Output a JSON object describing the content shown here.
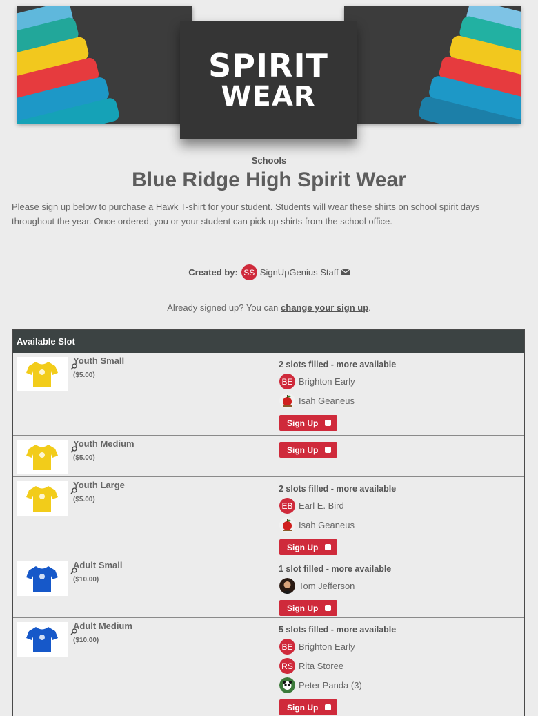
{
  "banner": {
    "line1": "SPIRIT",
    "line2": "WEAR"
  },
  "category": "Schools",
  "title": "Blue Ridge High Spirit Wear",
  "description": "Please sign up below to purchase a Hawk T-shirt for your student. Students will wear these shirts on school spirit days throughout the year.  Once ordered, you or your student can pick up shirts from the school office.",
  "creator": {
    "label": "Created by:",
    "initials": "SS",
    "name": "SignUpGenius Staff"
  },
  "already": {
    "prefix": "Already signed up? You can ",
    "link": "change your sign up",
    "suffix": "."
  },
  "table": {
    "header": "Available Slot",
    "signup_label": "Sign Up",
    "rows": [
      {
        "name": "Youth Small",
        "price": "($5.00)",
        "shirt_color": "#f2cc1a",
        "filled": "2 slots filled - more available",
        "people": [
          {
            "initials": "BE",
            "name": "Brighton Early",
            "avatar": "initials"
          },
          {
            "name": "Isah Geaneus",
            "avatar": "apple-icon"
          }
        ]
      },
      {
        "name": "Youth Medium",
        "price": "($5.00)",
        "shirt_color": "#f2cc1a",
        "filled": "",
        "people": []
      },
      {
        "name": "Youth Large",
        "price": "($5.00)",
        "shirt_color": "#f2cc1a",
        "filled": "2 slots filled - more available",
        "people": [
          {
            "initials": "EB",
            "name": "Earl E. Bird",
            "avatar": "initials"
          },
          {
            "name": "Isah Geaneus",
            "avatar": "apple-icon"
          }
        ]
      },
      {
        "name": "Adult Small",
        "price": "($10.00)",
        "shirt_color": "#1658c9",
        "filled": "1 slot filled - more available",
        "people": [
          {
            "name": "Tom Jefferson",
            "avatar": "portrait-photo"
          }
        ]
      },
      {
        "name": "Adult Medium",
        "price": "($10.00)",
        "shirt_color": "#1658c9",
        "filled": "5 slots filled - more available",
        "people": [
          {
            "initials": "BE",
            "name": "Brighton Early",
            "avatar": "initials"
          },
          {
            "initials": "RS",
            "name": "Rita Storee",
            "avatar": "initials"
          },
          {
            "name": "Peter Panda (3)",
            "avatar": "panda-photo"
          }
        ]
      }
    ]
  },
  "colors": {
    "accent": "#cf2a3b",
    "header_bg": "#3c4343",
    "page_bg": "#ececec"
  }
}
